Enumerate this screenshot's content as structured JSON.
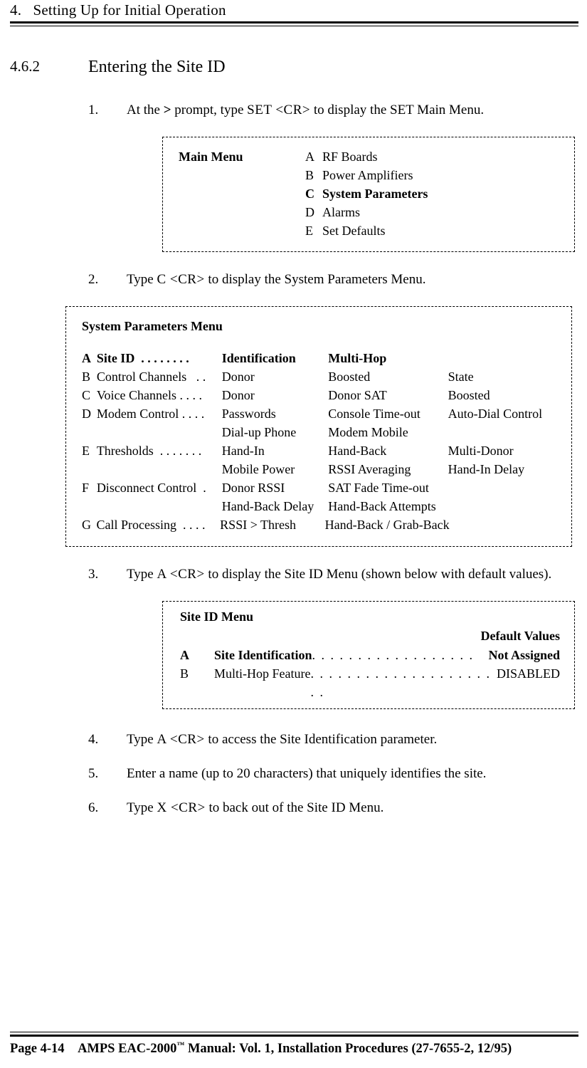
{
  "chapter": {
    "num": "4.",
    "title": "Setting Up for Initial Operation"
  },
  "section": {
    "num": "4.6.2",
    "title": "Entering the Site ID"
  },
  "steps": {
    "s1": {
      "num": "1.",
      "before": "At the ",
      "prompt": ">",
      "mid": " prompt, type ",
      "cmd": "SET <CR>",
      "after": " to display the SET Main Menu."
    },
    "s2": {
      "num": "2.",
      "before": "Type ",
      "cmd": "C <CR>",
      "after": " to display the System Parameters Menu."
    },
    "s3": {
      "num": "3.",
      "before": "Type ",
      "cmd": "A <CR>",
      "after": " to display the Site ID Menu (shown below with default values)."
    },
    "s4": {
      "num": "4.",
      "before": "Type ",
      "cmd": "A <CR>",
      "after": " to access the Site Identification parameter."
    },
    "s5": {
      "num": "5.",
      "text": "Enter a name (up to 20 characters) that uniquely identifies the site."
    },
    "s6": {
      "num": "6.",
      "before": "Type ",
      "cmd": "X <CR>",
      "after": " to back out of the Site ID Menu."
    }
  },
  "mainmenu": {
    "title": "Main Menu",
    "items": [
      {
        "k": "A",
        "label": "RF Boards",
        "bold": false
      },
      {
        "k": "B",
        "label": "Power Amplifiers",
        "bold": false
      },
      {
        "k": "C",
        "label": "System Parameters",
        "bold": true
      },
      {
        "k": "D",
        "label": "Alarms",
        "bold": false
      },
      {
        "k": "E",
        "label": "Set Defaults",
        "bold": false
      }
    ]
  },
  "sysmenu": {
    "title": "System Parameters Menu",
    "rows": [
      {
        "k": "A",
        "c1": "Site ID  . . . . . . . .",
        "c2": "Identification",
        "c3": "Multi-Hop",
        "c4": "",
        "bold": true
      },
      {
        "k": "B",
        "c1": "Control Channels   . .",
        "c2": "Donor",
        "c3": "Boosted",
        "c4": "State",
        "bold": false
      },
      {
        "k": "C",
        "c1": "Voice Channels . . . .",
        "c2": "Donor",
        "c3": "Donor SAT",
        "c4": "Boosted",
        "bold": false
      },
      {
        "k": "D",
        "c1": "Modem Control . . . .",
        "c2": "Passwords",
        "c3": "Console Time-out",
        "c4": "Auto-Dial Control",
        "bold": false
      },
      {
        "k": "",
        "c1": "",
        "c2": "Dial-up Phone",
        "c3": "Modem Mobile",
        "c4": "",
        "bold": false
      },
      {
        "k": "E",
        "c1": "Thresholds  . . . . . . .",
        "c2": "Hand-In",
        "c3": "Hand-Back",
        "c4": "Multi-Donor",
        "bold": false
      },
      {
        "k": "",
        "c1": "",
        "c2": "Mobile Power",
        "c3": "RSSI Averaging",
        "c4": "Hand-In Delay",
        "bold": false
      },
      {
        "k": "F",
        "c1": "Disconnect Control  .",
        "c2": "Donor RSSI",
        "c3": "SAT Fade Time-out",
        "c4": "",
        "bold": false
      },
      {
        "k": "",
        "c1": "",
        "c2": "Hand-Back Delay",
        "c3": "Hand-Back Attempts",
        "c4": "",
        "bold": false
      },
      {
        "k": "G",
        "c1": "Call Processing  . . . .",
        "c2": "RSSI > Thresh",
        "c3": "Hand-Back / Grab-Back",
        "c4": "",
        "bold": false
      }
    ]
  },
  "siteid": {
    "title": "Site ID Menu",
    "default_hdr": "Default Values",
    "rows": [
      {
        "k": "A",
        "label": "Site Identification",
        "dots": "  . . . . . . . . . . . . . . . . . .  ",
        "val": "Not Assigned",
        "bold": true
      },
      {
        "k": "B",
        "label": "Multi-Hop Feature",
        "dots": "  . . . . . . . . . . . . . . . . . . . . . . ",
        "val": "DISABLED",
        "bold": false
      }
    ]
  },
  "footer": {
    "page": "Page 4-14",
    "product": "AMPS EAC-2000",
    "tm": "™",
    "rest": " Manual:  Vol. 1, Installation Procedures (27-7655-2, 12/95)"
  }
}
